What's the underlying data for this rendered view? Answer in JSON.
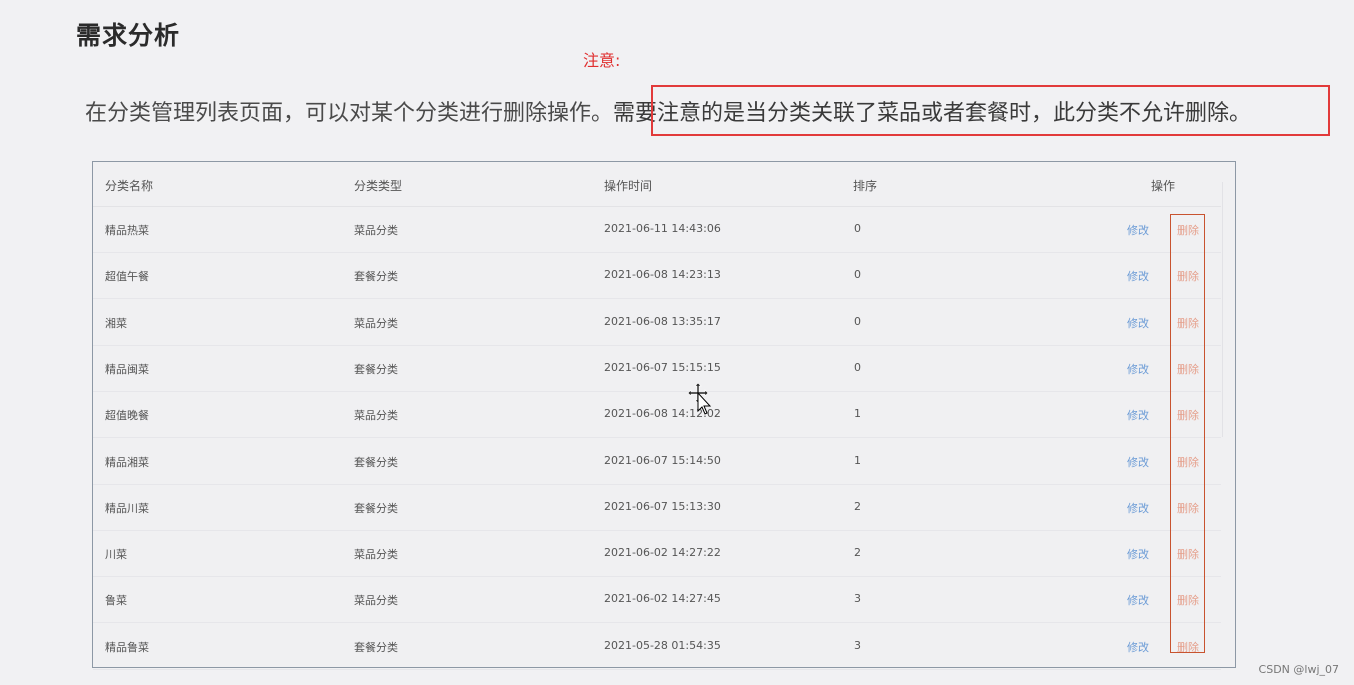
{
  "page_title": "需求分析",
  "note_label": "注意:",
  "description": {
    "part1": "在分类管理列表页面，可以对某个分类进行删除操作。",
    "part2": "需要注意的是当分类关联了菜品或者套餐时，此分类不允许删除。"
  },
  "table": {
    "headers": [
      "分类名称",
      "分类类型",
      "操作时间",
      "排序",
      "操作"
    ],
    "edit_label": "修改",
    "delete_label": "删除",
    "rows": [
      {
        "name": "精品热菜",
        "type": "菜品分类",
        "time": "2021-06-11 14:43:06",
        "sort": "0"
      },
      {
        "name": "超值午餐",
        "type": "套餐分类",
        "time": "2021-06-08 14:23:13",
        "sort": "0"
      },
      {
        "name": "湘菜",
        "type": "菜品分类",
        "time": "2021-06-08 13:35:17",
        "sort": "0"
      },
      {
        "name": "精品闽菜",
        "type": "套餐分类",
        "time": "2021-06-07 15:15:15",
        "sort": "0"
      },
      {
        "name": "超值晚餐",
        "type": "菜品分类",
        "time": "2021-06-08 14:12:02",
        "sort": "1"
      },
      {
        "name": "精品湘菜",
        "type": "套餐分类",
        "time": "2021-06-07 15:14:50",
        "sort": "1"
      },
      {
        "name": "精品川菜",
        "type": "套餐分类",
        "time": "2021-06-07 15:13:30",
        "sort": "2"
      },
      {
        "name": "川菜",
        "type": "菜品分类",
        "time": "2021-06-02 14:27:22",
        "sort": "2"
      },
      {
        "name": "鲁菜",
        "type": "菜品分类",
        "time": "2021-06-02 14:27:45",
        "sort": "3"
      },
      {
        "name": "精品鲁菜",
        "type": "套餐分类",
        "time": "2021-05-28 01:54:35",
        "sort": "3"
      }
    ]
  },
  "colors": {
    "highlight_border": "#e23a3a",
    "delete_box_border": "#c8532f",
    "edit_link": "#6b9bd6",
    "delete_link": "#e59e8a"
  },
  "watermark": "CSDN @lwj_07"
}
